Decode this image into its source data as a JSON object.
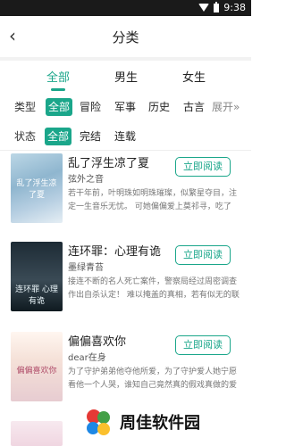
{
  "statusbar": {
    "time": "9:38"
  },
  "header": {
    "title": "分类",
    "back_glyph": "‹"
  },
  "gender_tabs": [
    {
      "label": "全部",
      "active": true
    },
    {
      "label": "男生",
      "active": false
    },
    {
      "label": "女生",
      "active": false
    }
  ],
  "type_filter": {
    "label": "类型",
    "options": [
      "全部",
      "冒险",
      "军事",
      "历史",
      "古言"
    ],
    "active_index": 0,
    "more": "展开"
  },
  "status_filter": {
    "label": "状态",
    "options": [
      "全部",
      "完结",
      "连载"
    ],
    "active_index": 0
  },
  "books": [
    {
      "title": "乱了浮生凉了夏",
      "author": "弦外之音",
      "desc": "若干年前，叶明珠如明珠璀璨，似繁星夺目，注定一生音乐无忧。 可她偏偏爱上莫祁寻，吃了苦，遭了难，...",
      "cover_text": "乱了浮生凉了夏",
      "read_label": "立即阅读"
    },
    {
      "title": "连环罪：心理有诡",
      "author": "墨绿青苔",
      "desc": "接连不断的名人死亡案件，警察局经过周密调查作出自杀认定！ 难以掩盖的真相，若有似无的联系，...",
      "cover_text": "连环罪 心理有诡",
      "read_label": "立即阅读"
    },
    {
      "title": "偏偏喜欢你",
      "author": "dear在身",
      "desc": "为了守护弟弟他夺他所爱，为了守护爱人她宁愿看他一个人哭，谁知自己竟然真的假戏真做的爱上了这个女生，爱情和亲情...",
      "cover_text": "偏偏喜欢你",
      "read_label": "立即阅读"
    }
  ],
  "watermark": {
    "text": "周佳软件园"
  },
  "colors": {
    "accent": "#1aa68a",
    "statusbar": "#1a1a1a"
  }
}
